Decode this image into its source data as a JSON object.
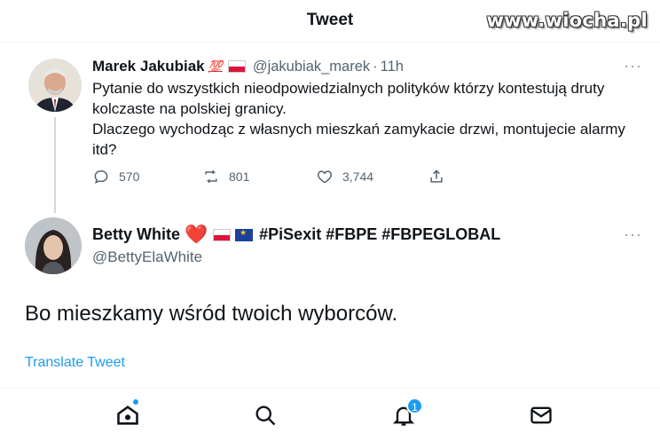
{
  "header": {
    "title": "Tweet",
    "watermark": "www.wiocha.pl"
  },
  "tweet1": {
    "name": "Marek Jakubiak",
    "badge_emoji": "💯",
    "handle": "@jakubiak_marek",
    "separator": "·",
    "time": "11h",
    "text": "Pytanie do wszystkich nieodpowiedzialnych polityków którzy kontestują druty kolczaste na polskiej granicy.\nDlaczego wychodząc z własnych mieszkań zamykacie drzwi, montujecie alarmy itd?",
    "replies": "570",
    "retweets": "801",
    "likes": "3,744",
    "icons": [
      "reply-icon",
      "retweet-icon",
      "like-icon",
      "share-icon",
      "more-icon"
    ]
  },
  "tweet2": {
    "name": "Betty White",
    "heart_emoji": "❤️",
    "hashtags": "#PiSexit #FBPE #FBPEGLOBAL",
    "handle": "@BettyElaWhite",
    "text": "Bo mieszkamy wśród twoich wyborców.",
    "translate_label": "Translate Tweet"
  },
  "tabbar": {
    "icons": [
      "home-icon",
      "search-icon",
      "notifications-icon",
      "messages-icon"
    ],
    "notification_count": "1"
  },
  "colors": {
    "accent": "#1d9bf0",
    "text": "#0f1419",
    "secondary": "#536471",
    "heart": "#e0245e"
  }
}
